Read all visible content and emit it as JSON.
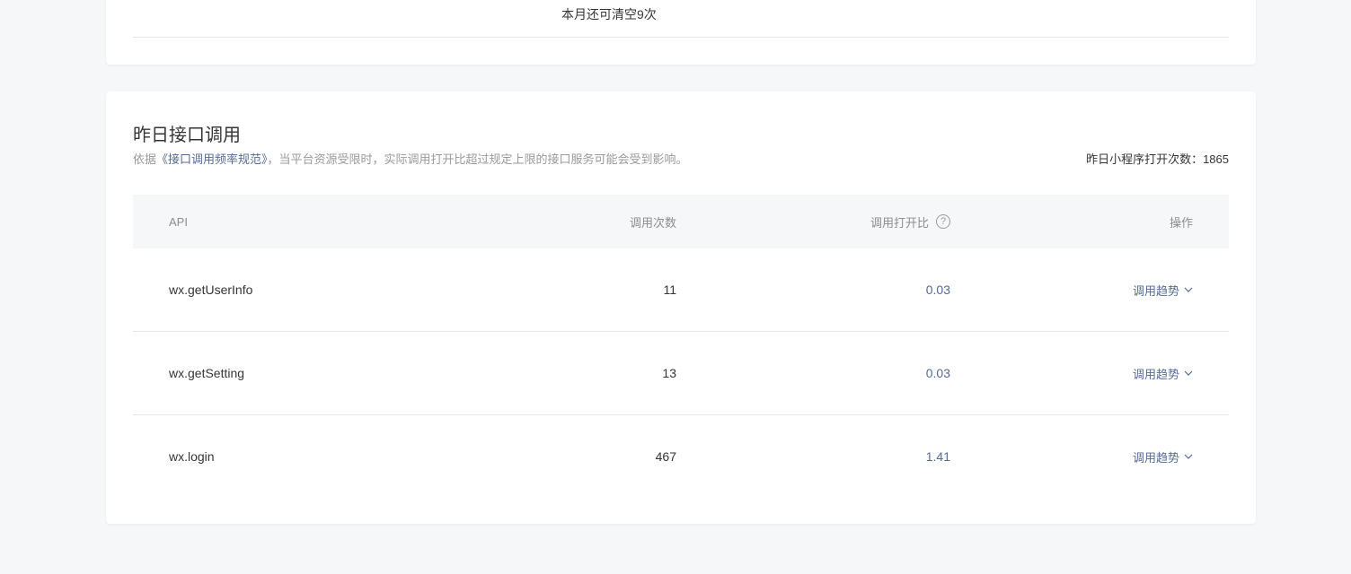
{
  "top_section": {
    "clear_quota_text": "本月还可清空9次"
  },
  "interface_calls": {
    "title": "昨日接口调用",
    "description_prefix": "依据",
    "description_link": "《接口调用频率规范》",
    "description_suffix": "，当平台资源受限时，实际调用打开比超过规定上限的接口服务可能会受到影响。",
    "open_count_label": "昨日小程序打开次数：1865",
    "table": {
      "headers": {
        "api": "API",
        "count": "调用次数",
        "ratio": "调用打开比",
        "help_icon": "?",
        "action": "操作"
      },
      "rows": [
        {
          "api": "wx.getUserInfo",
          "count": "11",
          "ratio": "0.03",
          "action": "调用趋势"
        },
        {
          "api": "wx.getSetting",
          "count": "13",
          "ratio": "0.03",
          "action": "调用趋势"
        },
        {
          "api": "wx.login",
          "count": "467",
          "ratio": "1.41",
          "action": "调用趋势"
        }
      ]
    }
  },
  "colors": {
    "background": "#f6f7f9",
    "link": "#576b95",
    "text": "#353535",
    "muted": "#9a9a9a"
  }
}
